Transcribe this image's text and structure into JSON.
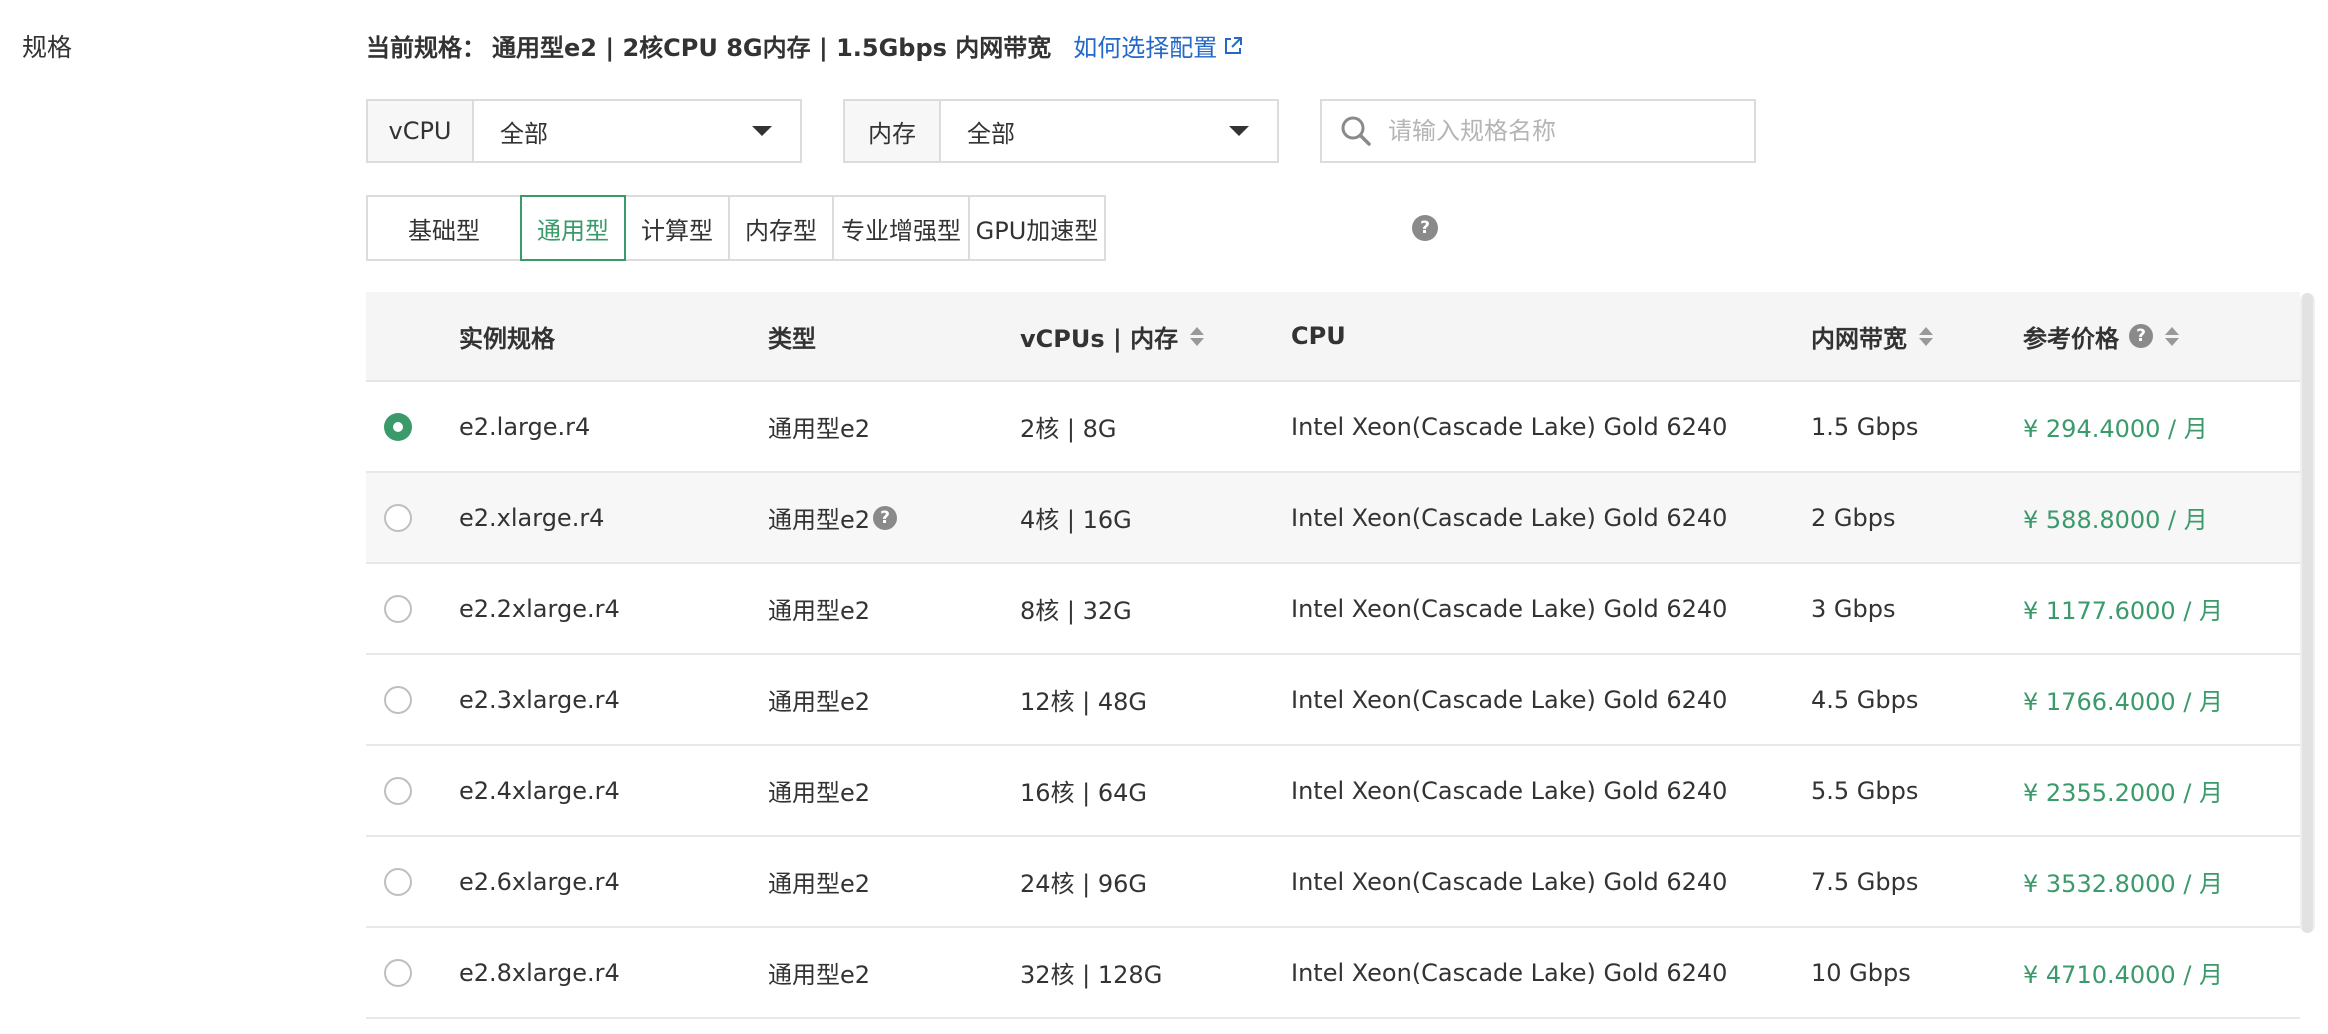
{
  "section_label": "规格",
  "current_spec": {
    "label": "当前规格：",
    "value": "通用型e2 | 2核CPU 8G内存 | 1.5Gbps 内网带宽",
    "help_link": "如何选择配置"
  },
  "filters": {
    "vcpu": {
      "label": "vCPU",
      "value": "全部"
    },
    "memory": {
      "label": "内存",
      "value": "全部"
    },
    "search": {
      "placeholder": "请输入规格名称",
      "value": ""
    }
  },
  "tabs": [
    "基础型",
    "通用型",
    "计算型",
    "内存型",
    "专业增强型",
    "GPU加速型"
  ],
  "active_tab": "通用型",
  "table": {
    "headers": {
      "spec": "实例规格",
      "type": "类型",
      "mem": "vCPUs | 内存",
      "cpu": "CPU",
      "bandwidth": "内网带宽",
      "price": "参考价格"
    },
    "rows": [
      {
        "spec": "e2.large.r4",
        "type": "通用型e2",
        "mem": "2核 | 8G",
        "cpu": "Intel Xeon(Cascade Lake) Gold 6240",
        "bandwidth": "1.5 Gbps",
        "price": "¥ 294.4000 / 月",
        "selected": true
      },
      {
        "spec": "e2.xlarge.r4",
        "type": "通用型e2",
        "mem": "4核 | 16G",
        "cpu": "Intel Xeon(Cascade Lake) Gold 6240",
        "bandwidth": "2 Gbps",
        "price": "¥ 588.8000 / 月",
        "selected": false
      },
      {
        "spec": "e2.2xlarge.r4",
        "type": "通用型e2",
        "mem": "8核 | 32G",
        "cpu": "Intel Xeon(Cascade Lake) Gold 6240",
        "bandwidth": "3 Gbps",
        "price": "¥ 1177.6000 / 月",
        "selected": false
      },
      {
        "spec": "e2.3xlarge.r4",
        "type": "通用型e2",
        "mem": "12核 | 48G",
        "cpu": "Intel Xeon(Cascade Lake) Gold 6240",
        "bandwidth": "4.5 Gbps",
        "price": "¥ 1766.4000 / 月",
        "selected": false
      },
      {
        "spec": "e2.4xlarge.r4",
        "type": "通用型e2",
        "mem": "16核 | 64G",
        "cpu": "Intel Xeon(Cascade Lake) Gold 6240",
        "bandwidth": "5.5 Gbps",
        "price": "¥ 2355.2000 / 月",
        "selected": false
      },
      {
        "spec": "e2.6xlarge.r4",
        "type": "通用型e2",
        "mem": "24核 | 96G",
        "cpu": "Intel Xeon(Cascade Lake) Gold 6240",
        "bandwidth": "7.5 Gbps",
        "price": "¥ 3532.8000 / 月",
        "selected": false
      },
      {
        "spec": "e2.8xlarge.r4",
        "type": "通用型e2",
        "mem": "32核 | 128G",
        "cpu": "Intel Xeon(Cascade Lake) Gold 6240",
        "bandwidth": "10 Gbps",
        "price": "¥ 4710.4000 / 月",
        "selected": false
      }
    ]
  },
  "colors": {
    "accent": "#3a9a6a",
    "link": "#2468c8"
  },
  "icons": [
    "external-link-icon",
    "chevron-down-icon",
    "search-icon",
    "help-icon",
    "sort-icon",
    "radio-icon"
  ]
}
